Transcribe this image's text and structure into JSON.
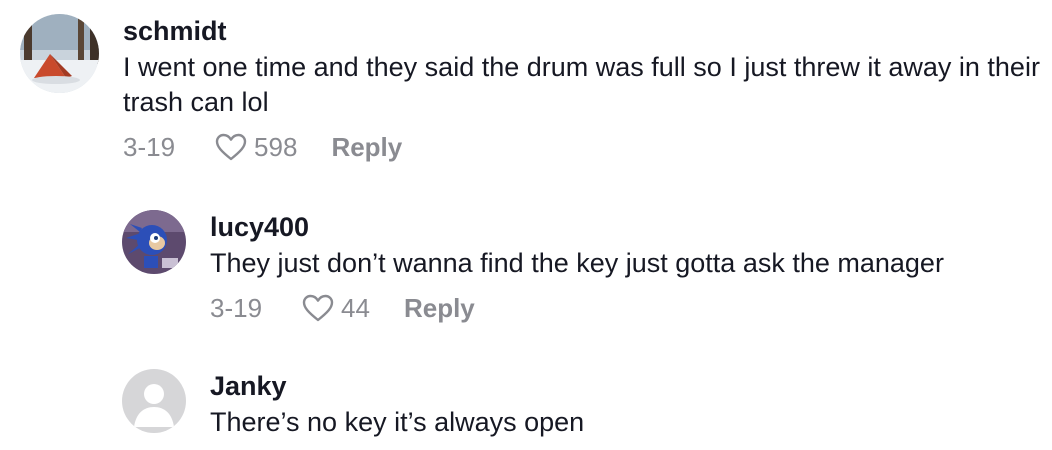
{
  "comments": [
    {
      "username": "schmidt",
      "text": "I went one time and they said the drum was full so I just threw it away in their trash can lol",
      "date": "3-19",
      "likes": "598",
      "reply_label": "Reply",
      "avatar": "snowy-camping-tent-photo"
    },
    {
      "username": "lucy400",
      "text": "They just don’t wanna find the key just gotta ask the manager",
      "date": "3-19",
      "likes": "44",
      "reply_label": "Reply",
      "avatar": "blue-hedgehog-character-image"
    },
    {
      "username": "Janky",
      "text": "There’s no key it’s always open",
      "avatar": "default-profile-placeholder"
    }
  ],
  "icons": {
    "like": "heart-outline-icon"
  },
  "colors": {
    "text_primary": "#161823",
    "text_secondary": "#8a8b91",
    "avatar_placeholder": "#d6d6d8"
  }
}
